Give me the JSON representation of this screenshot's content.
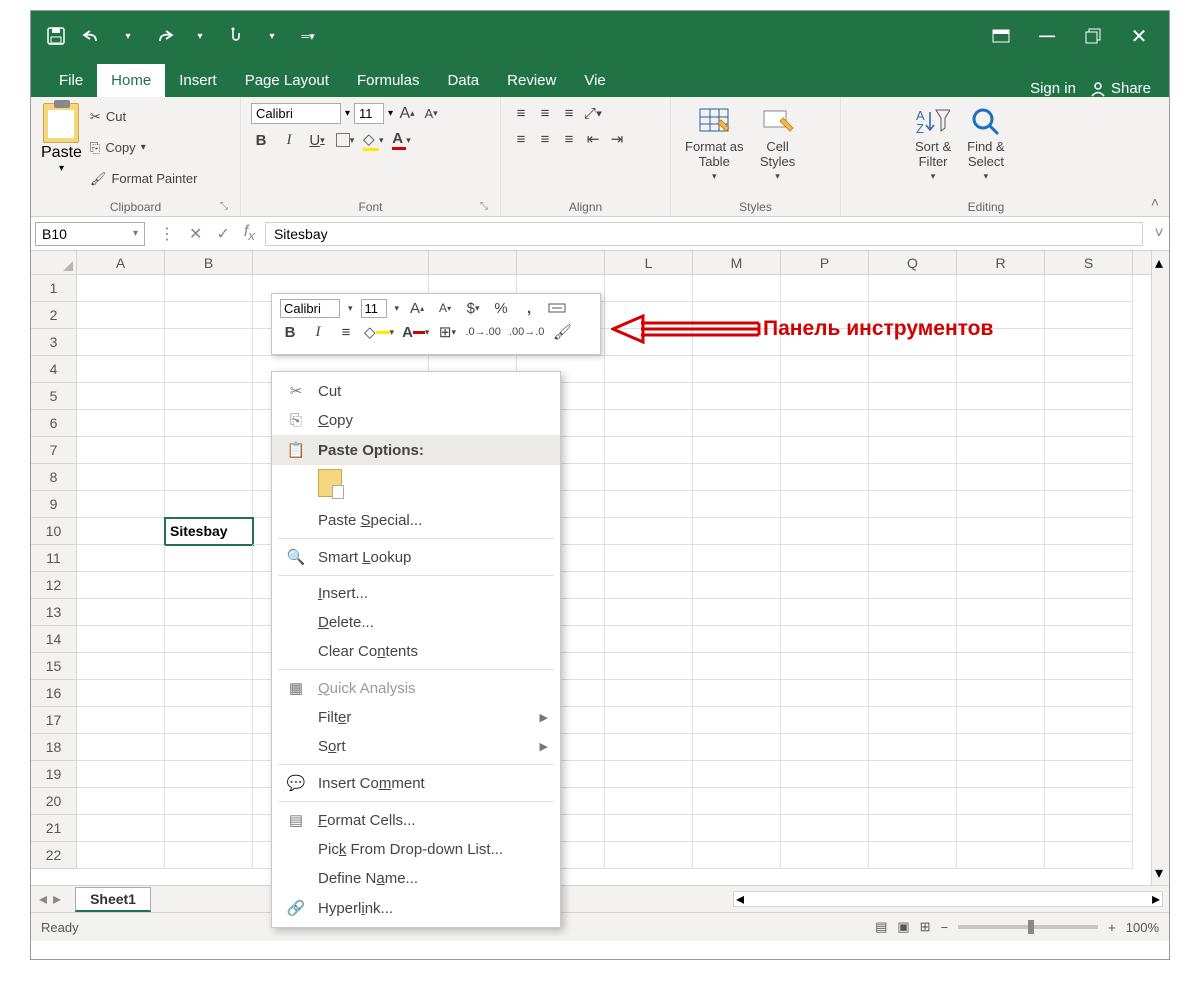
{
  "titlebar": {},
  "tabs": {
    "file": "File",
    "home": "Home",
    "insert": "Insert",
    "page_layout": "Page Layout",
    "formulas": "Formulas",
    "data": "Data",
    "review": "Review",
    "view": "Vie",
    "signin": "Sign in",
    "share": "Share"
  },
  "ribbon": {
    "clipboard": {
      "paste": "Paste",
      "cut": "Cut",
      "copy": "Copy",
      "format_painter": "Format Painter",
      "label": "Clipboard"
    },
    "font": {
      "name": "Calibri",
      "size": "11",
      "label": "Font"
    },
    "alignment": {
      "label": "Alignn"
    },
    "styles": {
      "format_as_table": "Format as\nTable",
      "cell_styles": "Cell\nStyles",
      "label": "Styles"
    },
    "editing": {
      "sort_filter": "Sort &\nFilter",
      "find_select": "Find &\nSelect",
      "label": "Editing"
    }
  },
  "formula_bar": {
    "name_box": "B10",
    "value": "Sitesbay"
  },
  "grid": {
    "columns": [
      "A",
      "B",
      "",
      "",
      "",
      "L",
      "M",
      "P",
      "Q",
      "R",
      "S"
    ],
    "row_count": 22,
    "active_cell": {
      "row": 10,
      "col": "B",
      "value": "Sitesbay"
    }
  },
  "mini_toolbar": {
    "font": "Calibri",
    "size": "11"
  },
  "context_menu": {
    "cut": "Cut",
    "copy": "Copy",
    "paste_options": "Paste Options:",
    "paste_special": "Paste Special...",
    "smart_lookup": "Smart Lookup",
    "insert": "Insert...",
    "delete": "Delete...",
    "clear_contents": "Clear Contents",
    "quick_analysis": "Quick Analysis",
    "filter": "Filter",
    "sort": "Sort",
    "insert_comment": "Insert Comment",
    "format_cells": "Format Cells...",
    "pick_from_list": "Pick From Drop-down List...",
    "define_name": "Define Name...",
    "hyperlink": "Hyperlink..."
  },
  "annotation": {
    "text": "Панель инструментов"
  },
  "sheet_tabs": {
    "sheet1": "Sheet1"
  },
  "status_bar": {
    "ready": "Ready",
    "zoom": "100%"
  }
}
